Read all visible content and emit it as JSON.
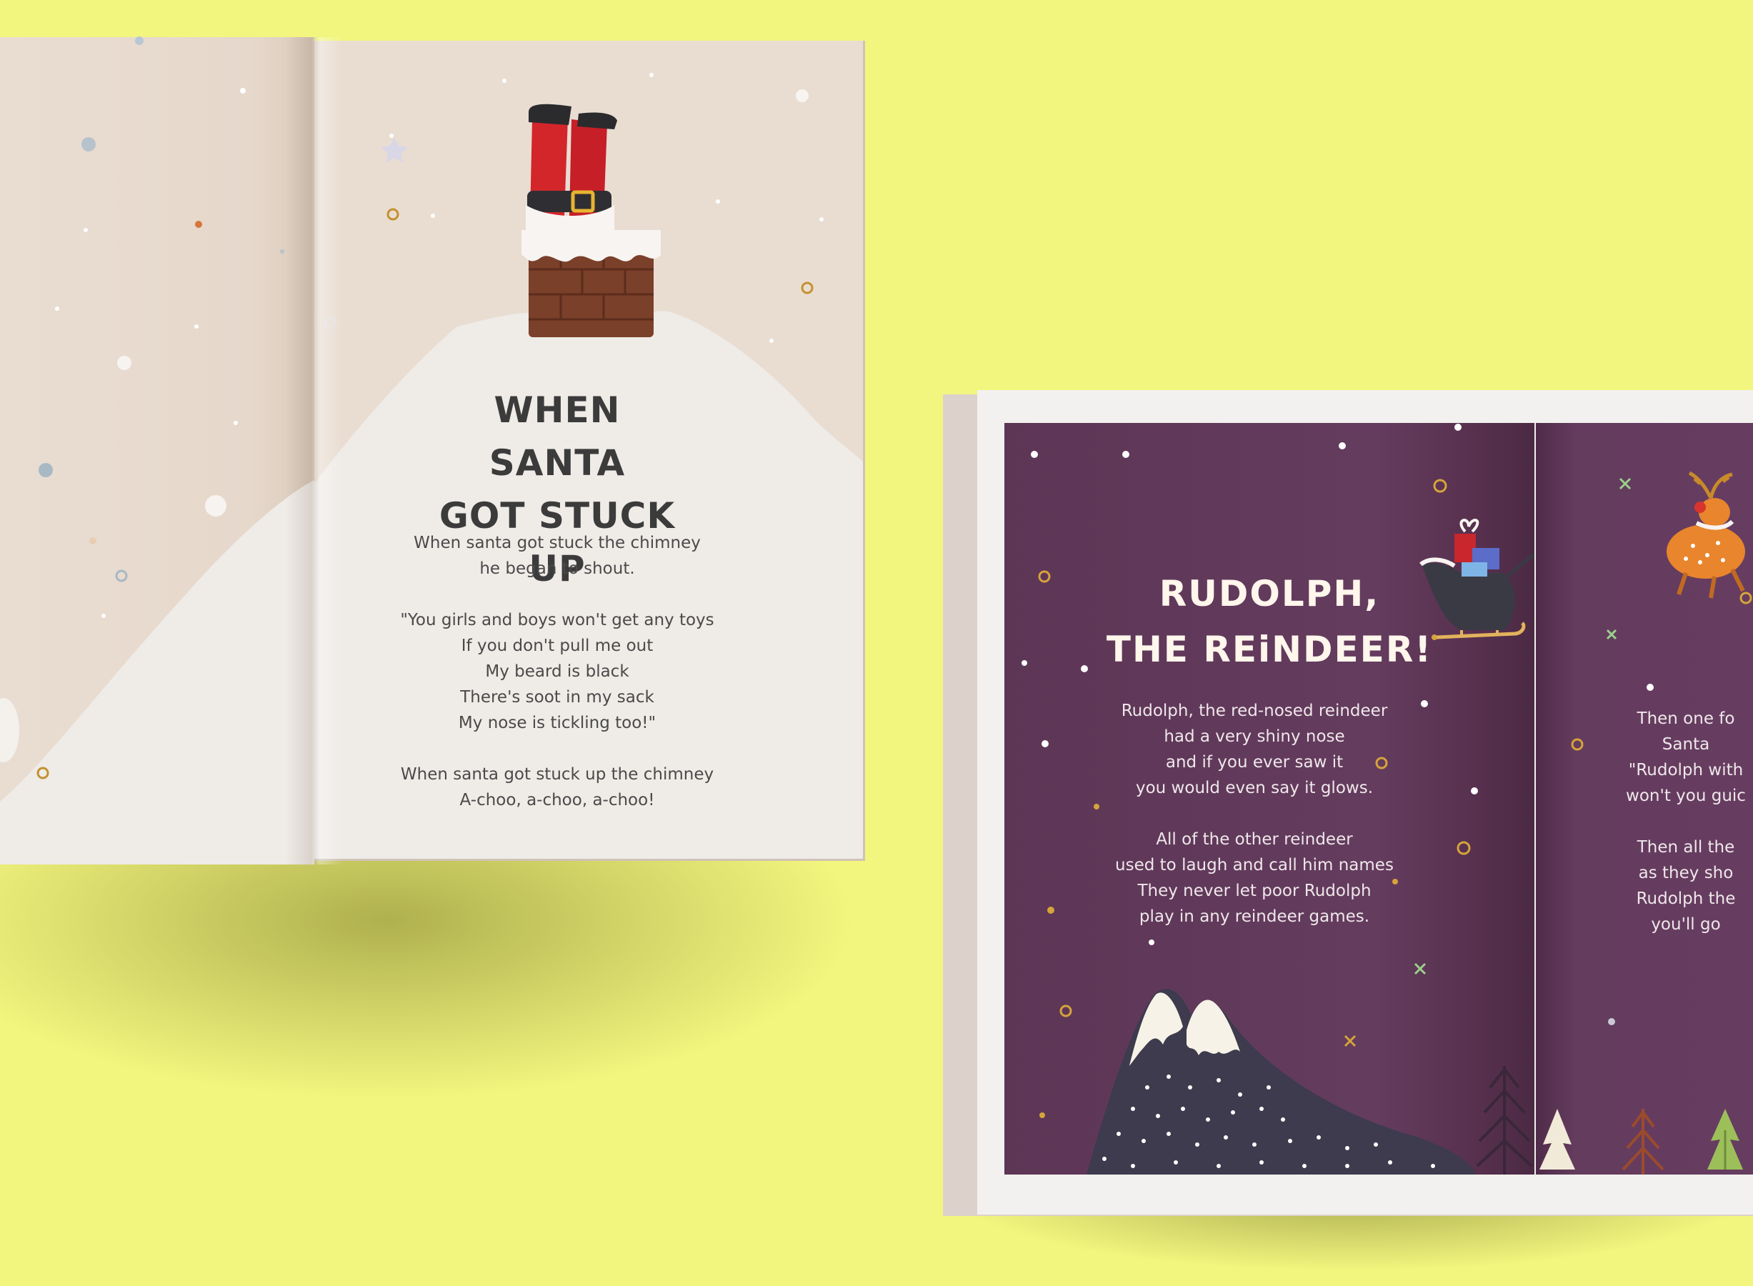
{
  "scene": {
    "background_color": "#f2f57e"
  },
  "book_left": {
    "page_color": "#e9ddd2",
    "title_lines": [
      "WHEN SANTA",
      "GOT STUCK UP"
    ],
    "stanzas": [
      [
        "When santa got stuck the chimney",
        "he began to shout."
      ],
      [
        "\"You girls and boys won't get any toys",
        "If you don't pull me out",
        "My beard is black",
        "There's soot in my sack",
        "My nose is tickling too!\""
      ],
      [
        "When santa got stuck up the chimney",
        "A-choo, a-choo, a-choo!"
      ]
    ],
    "illustrations": [
      "santa-legs-icon",
      "chimney-icon",
      "snow-hill-icon"
    ]
  },
  "book_right": {
    "page_color": "#643c5e",
    "title_lines": [
      "RUDOLPH,",
      "THE REiNDEER!"
    ],
    "stanzas": [
      [
        "Rudolph, the red-nosed reindeer",
        "had a very shiny nose",
        "and if you ever saw it",
        "you would even say it glows."
      ],
      [
        "All of the other reindeer",
        "used to laugh and call him names",
        "They never let poor Rudolph",
        "play in any reindeer games."
      ]
    ],
    "next_page_stanzas": [
      [
        "Then one fo",
        "Santa",
        "\"Rudolph with",
        "won't you guic"
      ],
      [
        "Then all the",
        "as they sho",
        "Rudolph the",
        "you'll go"
      ]
    ],
    "illustrations": [
      "sleigh-icon",
      "reindeer-icon",
      "mountains-icon",
      "pine-tree-icon"
    ]
  }
}
